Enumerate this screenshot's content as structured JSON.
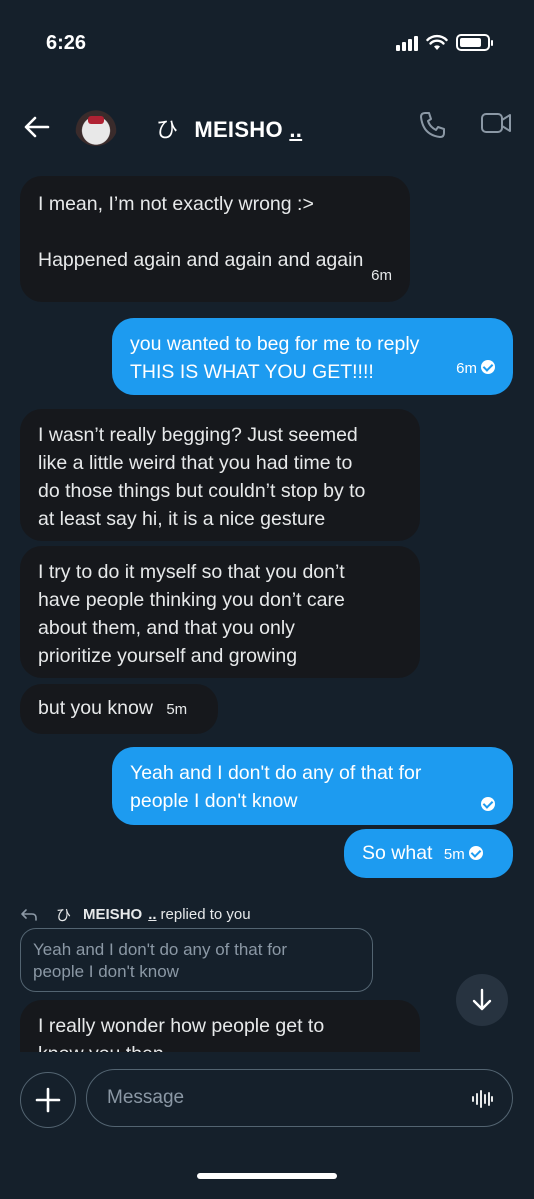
{
  "status_bar": {
    "time": "6:26"
  },
  "header": {
    "name_glyph": "ひ",
    "name": "MEISHO",
    "name_suffix": ".."
  },
  "messages": [
    {
      "direction": "received",
      "lines": [
        "I mean, I’m not exactly wrong :>",
        "",
        "Happened again and again and again"
      ],
      "time": "6m"
    },
    {
      "direction": "sent",
      "lines": [
        "you wanted to beg for me to reply",
        "THIS IS WHAT YOU GET!!!!"
      ],
      "time": "6m"
    },
    {
      "direction": "received",
      "lines": [
        "I wasn’t really begging? Just seemed",
        "like a little weird that you had time to",
        "do those things but couldn’t stop by to",
        "at least say hi, it is a nice gesture"
      ]
    },
    {
      "direction": "received",
      "lines": [
        "I try to do it myself so that you don’t",
        "have people thinking you don’t care",
        "about them, and that you only",
        "prioritize yourself and growing"
      ]
    },
    {
      "direction": "received",
      "lines": [
        "but you know"
      ],
      "time": "5m"
    },
    {
      "direction": "sent",
      "lines": [
        "Yeah and I don't do any of that for",
        "people I don't know"
      ]
    },
    {
      "direction": "sent",
      "lines": [
        "So what"
      ],
      "time": "5m"
    },
    {
      "direction": "received",
      "lines": [
        "I really wonder how people get to",
        "know you then"
      ]
    }
  ],
  "reply_context": {
    "glyph": "ひ",
    "name": "MEISHO",
    "suffix": "..",
    "action": "replied to you",
    "quoted_lines": [
      "Yeah and I don't do any of that for",
      "people I don't know"
    ]
  },
  "composer": {
    "placeholder": "Message"
  },
  "icons": {
    "back": "arrow-left-icon",
    "phone": "phone-icon",
    "video": "video-camera-icon",
    "reply": "reply-arrow-icon",
    "scroll": "arrow-down-icon",
    "add": "plus-icon",
    "voice": "voice-waveform-icon"
  },
  "colors": {
    "background": "#15202b",
    "sent_bubble": "#1d9bf0",
    "received_bubble": "#16181c"
  }
}
